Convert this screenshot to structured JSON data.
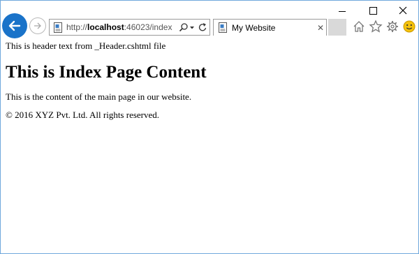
{
  "browser": {
    "address_bar": {
      "url_prefix": "http://",
      "url_host": "localhost",
      "url_rest": ":46023/index"
    },
    "tab": {
      "title": "My Website",
      "close_glyph": "✕"
    },
    "icons": [
      "back-arrow-icon",
      "forward-arrow-icon",
      "page-icon",
      "search-icon",
      "dropdown-arrow-icon",
      "refresh-icon",
      "home-icon",
      "star-icon",
      "gear-icon",
      "smiley-icon",
      "minimize-icon",
      "maximize-icon",
      "close-icon"
    ],
    "colors": {
      "back_button": "#1a73c9",
      "window_border": "#6fa8dc",
      "smiley": "#f4c20d"
    }
  },
  "page": {
    "header_text": "This is header text from _Header.cshtml file",
    "heading": "This is Index Page Content",
    "main_text": "This is the content of the main page in our website.",
    "footer_text": "© 2016 XYZ Pvt. Ltd. All rights reserved."
  }
}
